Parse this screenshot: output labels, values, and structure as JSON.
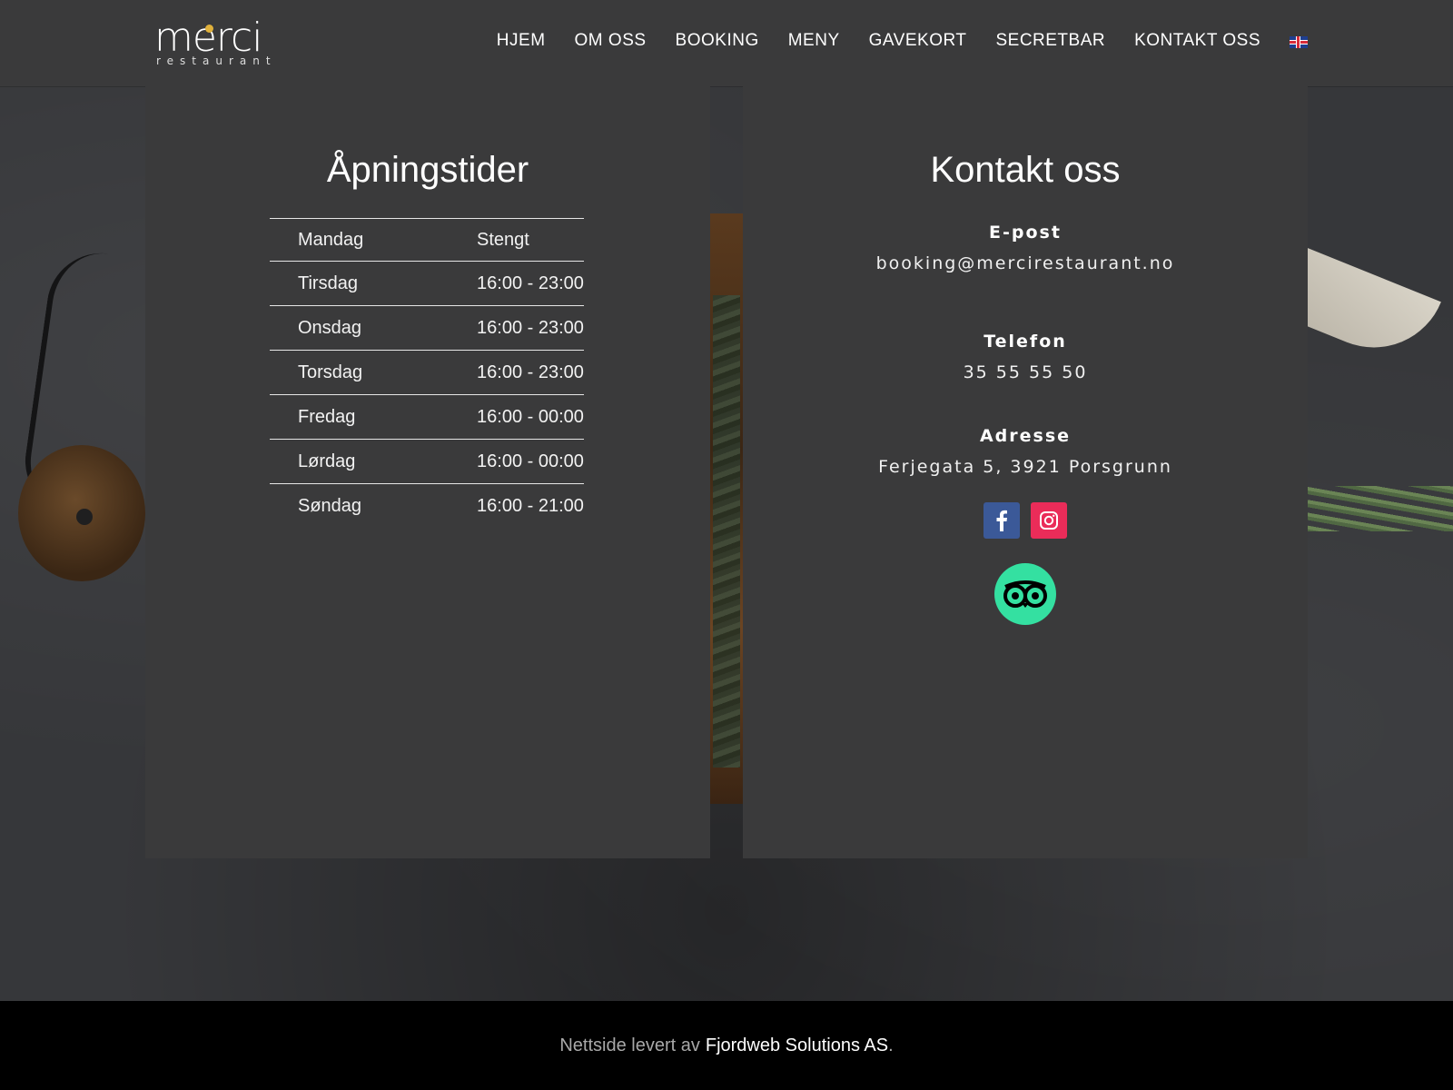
{
  "header": {
    "logo": {
      "word": "merci",
      "subtitle": "restaurant",
      "accent": "#e0b13b"
    },
    "nav": [
      "HJEM",
      "OM OSS",
      "BOOKING",
      "MENY",
      "GAVEKORT",
      "SECRETBAR",
      "KONTAKT OSS"
    ],
    "language_icon": "uk-flag-icon"
  },
  "hours": {
    "title": "Åpningstider",
    "rows": [
      {
        "day": "Mandag",
        "time": "Stengt"
      },
      {
        "day": "Tirsdag",
        "time": "16:00 - 23:00"
      },
      {
        "day": "Onsdag",
        "time": "16:00 - 23:00"
      },
      {
        "day": "Torsdag",
        "time": "16:00 - 23:00"
      },
      {
        "day": "Fredag",
        "time": "16:00 - 00:00"
      },
      {
        "day": "Lørdag",
        "time": "16:00 - 00:00"
      },
      {
        "day": "Søndag",
        "time": "16:00 - 21:00"
      }
    ]
  },
  "contact": {
    "title": "Kontakt oss",
    "email_label": "E-post",
    "email": "booking@mercirestaurant.no",
    "phone_label": "Telefon",
    "phone": "35 55 55 50",
    "address_label": "Adresse",
    "address": "Ferjegata 5, 3921 Porsgrunn",
    "social": [
      {
        "icon": "facebook-icon",
        "color": "#3b5998"
      },
      {
        "icon": "instagram-icon",
        "color": "#ea2c59"
      }
    ],
    "tripadvisor": {
      "icon": "tripadvisor-icon",
      "color": "#34e0a1"
    }
  },
  "footer": {
    "prefix": "Nettside levert av",
    "link": "Fjordweb Solutions AS",
    "suffix": "."
  }
}
